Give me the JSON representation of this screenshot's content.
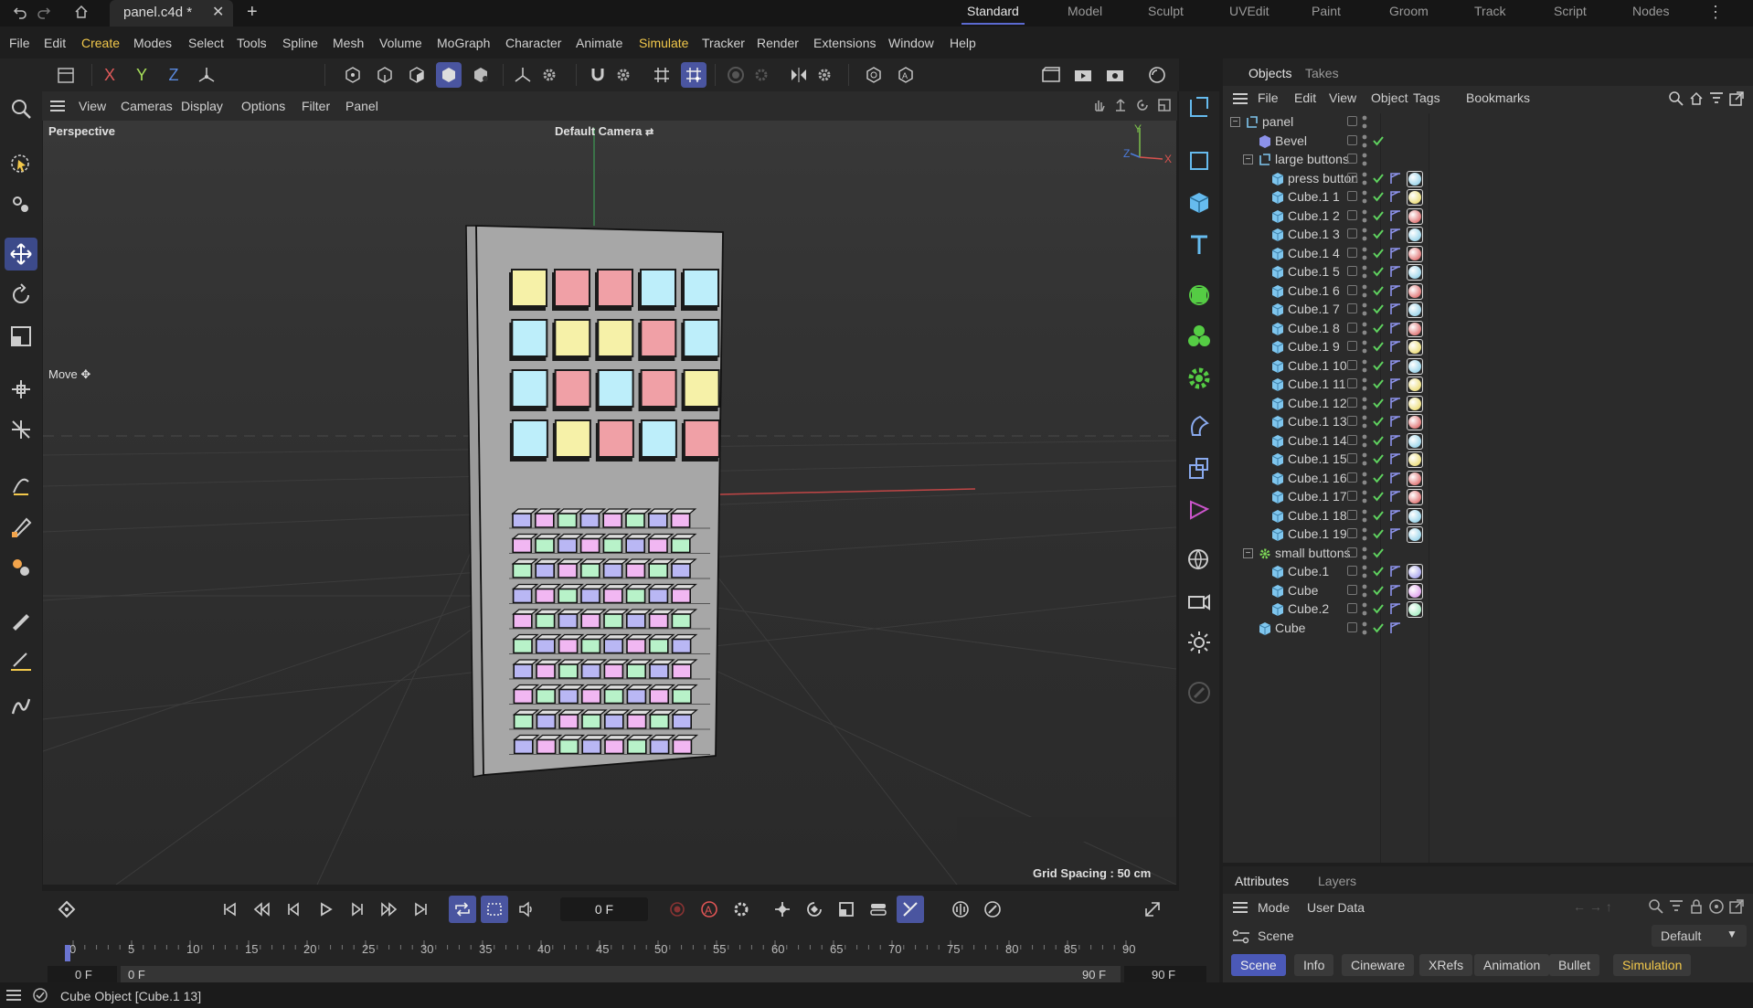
{
  "titlebar": {
    "file_tab": "panel.c4d *",
    "layouts": [
      "Standard",
      "Model",
      "Sculpt",
      "UVEdit",
      "Paint",
      "Groom",
      "Track",
      "Script",
      "Nodes"
    ],
    "active_layout": "Standard"
  },
  "menubar": [
    "File",
    "Edit",
    "Create",
    "Modes",
    "Select",
    "Tools",
    "Spline",
    "Mesh",
    "Volume",
    "MoGraph",
    "Character",
    "Animate",
    "Simulate",
    "Tracker",
    "Render",
    "Extensions",
    "Window",
    "Help"
  ],
  "toolbar": {
    "axis_x": "X",
    "axis_y": "Y",
    "axis_z": "Z"
  },
  "viewport": {
    "menu": [
      "View",
      "Cameras",
      "Display",
      "Options",
      "Filter",
      "Panel"
    ],
    "projection": "Perspective",
    "camera": "Default Camera",
    "hud_move": "Move",
    "grid_spacing": "Grid Spacing : 50 cm",
    "axis_labels": {
      "y": "Y",
      "z": "Z",
      "x": "X"
    }
  },
  "objects_panel": {
    "tabs": [
      "Objects",
      "Takes"
    ],
    "menu": [
      "File",
      "Edit",
      "View",
      "Object",
      "Tags",
      "Bookmarks"
    ],
    "tree": [
      {
        "name": "panel",
        "depth": 0,
        "icon": "null",
        "fold": true,
        "check": false,
        "tags": false
      },
      {
        "name": "Bevel",
        "depth": 1,
        "icon": "bevel",
        "fold": false,
        "check": true,
        "tags": false
      },
      {
        "name": "large buttons",
        "depth": 1,
        "icon": "null",
        "fold": true,
        "check": false,
        "tags": false
      },
      {
        "name": "press button",
        "depth": 2,
        "icon": "cube",
        "fold": false,
        "check": true,
        "tags": true,
        "mat": "#9ad4ea"
      },
      {
        "name": "Cube.1 1",
        "depth": 2,
        "icon": "cube",
        "check": true,
        "tags": true,
        "mat": "#ecdd7a"
      },
      {
        "name": "Cube.1 2",
        "depth": 2,
        "icon": "cube",
        "check": true,
        "tags": true,
        "mat": "#e07474"
      },
      {
        "name": "Cube.1 3",
        "depth": 2,
        "icon": "cube",
        "check": true,
        "tags": true,
        "mat": "#9ad4ea"
      },
      {
        "name": "Cube.1 4",
        "depth": 2,
        "icon": "cube",
        "check": true,
        "tags": true,
        "mat": "#e07474"
      },
      {
        "name": "Cube.1 5",
        "depth": 2,
        "icon": "cube",
        "check": true,
        "tags": true,
        "mat": "#9ad4ea"
      },
      {
        "name": "Cube.1 6",
        "depth": 2,
        "icon": "cube",
        "check": true,
        "tags": true,
        "mat": "#e07474"
      },
      {
        "name": "Cube.1 7",
        "depth": 2,
        "icon": "cube",
        "check": true,
        "tags": true,
        "mat": "#9ad4ea"
      },
      {
        "name": "Cube.1 8",
        "depth": 2,
        "icon": "cube",
        "check": true,
        "tags": true,
        "mat": "#e07474"
      },
      {
        "name": "Cube.1 9",
        "depth": 2,
        "icon": "cube",
        "check": true,
        "tags": true,
        "mat": "#ecdd7a"
      },
      {
        "name": "Cube.1 10",
        "depth": 2,
        "icon": "cube",
        "check": true,
        "tags": true,
        "mat": "#9ad4ea"
      },
      {
        "name": "Cube.1 11",
        "depth": 2,
        "icon": "cube",
        "check": true,
        "tags": true,
        "mat": "#ecdd7a"
      },
      {
        "name": "Cube.1 12",
        "depth": 2,
        "icon": "cube",
        "check": true,
        "tags": true,
        "mat": "#ecdd7a"
      },
      {
        "name": "Cube.1 13",
        "depth": 2,
        "icon": "cube",
        "check": true,
        "tags": true,
        "mat": "#e07474"
      },
      {
        "name": "Cube.1 14",
        "depth": 2,
        "icon": "cube",
        "check": true,
        "tags": true,
        "mat": "#9ad4ea"
      },
      {
        "name": "Cube.1 15",
        "depth": 2,
        "icon": "cube",
        "check": true,
        "tags": true,
        "mat": "#ecdd7a"
      },
      {
        "name": "Cube.1 16",
        "depth": 2,
        "icon": "cube",
        "check": true,
        "tags": true,
        "mat": "#e07474"
      },
      {
        "name": "Cube.1 17",
        "depth": 2,
        "icon": "cube",
        "check": true,
        "tags": true,
        "mat": "#e07474"
      },
      {
        "name": "Cube.1 18",
        "depth": 2,
        "icon": "cube",
        "check": true,
        "tags": true,
        "mat": "#9ad4ea"
      },
      {
        "name": "Cube.1 19",
        "depth": 2,
        "icon": "cube",
        "check": true,
        "tags": true,
        "mat": "#9ad4ea"
      },
      {
        "name": "small buttons",
        "depth": 1,
        "icon": "cloner",
        "fold": true,
        "check": true,
        "tags": false
      },
      {
        "name": "Cube.1",
        "depth": 2,
        "icon": "cube",
        "check": true,
        "tags": true,
        "mat": "#a9a6ee"
      },
      {
        "name": "Cube",
        "depth": 2,
        "icon": "cube",
        "check": true,
        "tags": true,
        "mat": "#e1a3ee"
      },
      {
        "name": "Cube.2",
        "depth": 2,
        "icon": "cube",
        "check": true,
        "tags": true,
        "mat": "#a6ecc2"
      },
      {
        "name": "Cube",
        "depth": 1,
        "icon": "cube",
        "check": true,
        "tags": "phong"
      }
    ]
  },
  "attributes_panel": {
    "tabs": [
      "Attributes",
      "Layers"
    ],
    "mode": "Mode",
    "user_data": "User Data",
    "scene": "Scene",
    "default": "Default",
    "buttons": [
      "Scene",
      "Info",
      "Cineware",
      "XRefs",
      "Animation",
      "Bullet",
      "Simulation"
    ]
  },
  "timeline": {
    "current_frame": "0 F",
    "ruler": [
      "0",
      "5",
      "10",
      "15",
      "20",
      "25",
      "30",
      "35",
      "40",
      "45",
      "50",
      "55",
      "60",
      "65",
      "70",
      "75",
      "80",
      "85",
      "90"
    ],
    "range_start": "0 F",
    "range_start2": "0 F",
    "range_end": "90 F",
    "range_end2": "90 F"
  },
  "statusbar": {
    "text": "Cube Object [Cube.1 13]"
  },
  "scene": {
    "large_buttons": [
      [
        "#f6f1a8",
        "#f0a0a6",
        "#f0a0a6",
        "#bdeefa",
        "#bdeefa"
      ],
      [
        "#bdeefa",
        "#f6f1a8",
        "#f6f1a8",
        "#f0a0a6",
        "#bdeefa"
      ],
      [
        "#bdeefa",
        "#f0a0a6",
        "#bdeefa",
        "#f0a0a6",
        "#f6f1a8"
      ],
      [
        "#bdeefa",
        "#f6f1a8",
        "#f0a0a6",
        "#bdeefa",
        "#f0a0a6"
      ]
    ],
    "small_button_colors": [
      "#b9b7f4",
      "#f1b7f2",
      "#b8f2c9"
    ]
  }
}
